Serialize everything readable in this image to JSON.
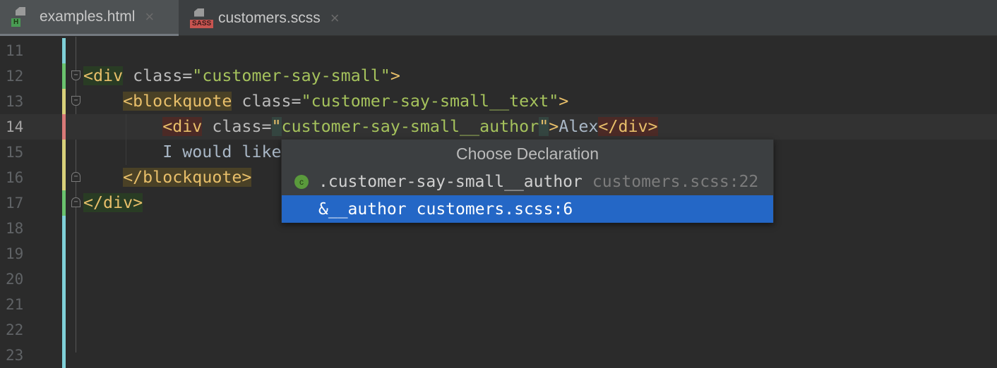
{
  "tabs": [
    {
      "label": "examples.html",
      "badge": "H",
      "badge_color": "#499c54",
      "active": true
    },
    {
      "label": "customers.scss",
      "badge": "SASS",
      "badge_color": "#c75450",
      "active": false
    }
  ],
  "close_glyph": "×",
  "lines": [
    {
      "n": "11",
      "tokens": []
    },
    {
      "n": "12",
      "tokens": [
        {
          "c": "t hg",
          "v": "<div"
        },
        {
          "c": "a",
          "v": " class="
        },
        {
          "c": "s",
          "v": "\"customer-say-small\""
        },
        {
          "c": "t",
          "v": ">"
        }
      ]
    },
    {
      "n": "13",
      "tokens": [
        {
          "c": "x",
          "v": "    "
        },
        {
          "c": "t hy",
          "v": "<blockquote"
        },
        {
          "c": "a",
          "v": " class="
        },
        {
          "c": "s",
          "v": "\"customer-say-small__text\""
        },
        {
          "c": "t",
          "v": ">"
        }
      ]
    },
    {
      "n": "14",
      "tokens": [
        {
          "c": "x",
          "v": "        "
        },
        {
          "c": "t hr",
          "v": "<div"
        },
        {
          "c": "a",
          "v": " class="
        },
        {
          "c": "t hc",
          "v": "\""
        },
        {
          "c": "s",
          "v": "customer-say-small__author"
        },
        {
          "c": "t hc",
          "v": "\""
        },
        {
          "c": "t",
          "v": ">"
        },
        {
          "c": "x",
          "v": "Alex"
        },
        {
          "c": "t hr",
          "v": "</div>"
        }
      ]
    },
    {
      "n": "15",
      "tokens": [
        {
          "c": "x",
          "v": "        I would like"
        }
      ]
    },
    {
      "n": "16",
      "tokens": [
        {
          "c": "x",
          "v": "    "
        },
        {
          "c": "t hy",
          "v": "</blockquote>"
        }
      ]
    },
    {
      "n": "17",
      "tokens": [
        {
          "c": "t hg",
          "v": "</div>"
        }
      ]
    },
    {
      "n": "18",
      "tokens": []
    },
    {
      "n": "19",
      "tokens": []
    },
    {
      "n": "20",
      "tokens": []
    },
    {
      "n": "21",
      "tokens": []
    },
    {
      "n": "22",
      "tokens": []
    },
    {
      "n": "23",
      "tokens": []
    }
  ],
  "popup": {
    "title": "Choose Declaration",
    "items": [
      {
        "icon": "c",
        "name": ".customer-say-small__author",
        "location": "customers.scss:22",
        "selected": false
      },
      {
        "name": "&__author",
        "location": "customers.scss:6",
        "selected": true
      }
    ]
  }
}
